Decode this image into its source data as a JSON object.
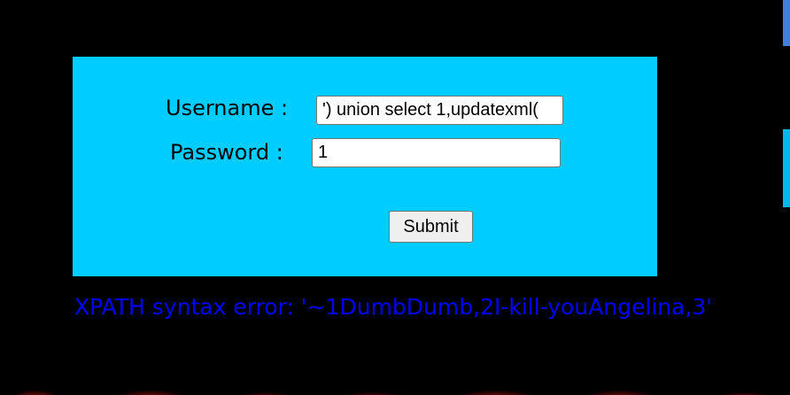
{
  "form": {
    "username_label": "Username :",
    "username_value": "') union select 1,updatexml(",
    "password_label": "Password :",
    "password_value": "1",
    "submit_label": "Submit"
  },
  "error": {
    "message": "XPATH syntax error: '~1DumbDumb,2I-kill-youAngelina,3'"
  },
  "colors": {
    "page_background": "#000000",
    "panel_background": "#00ccff",
    "error_text": "#0000ff",
    "glow": "#c81414"
  }
}
